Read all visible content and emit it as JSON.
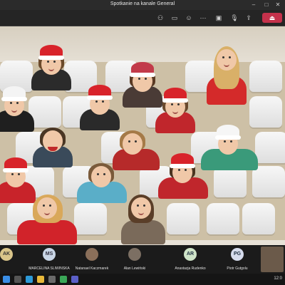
{
  "window": {
    "title": "Spotkanie na kanale General"
  },
  "toolbar": {
    "icons": [
      "participants-icon",
      "chat-icon",
      "reactions-icon",
      "more-icon",
      "camera-icon",
      "mic-icon",
      "share-icon"
    ],
    "leave_label": "⏏"
  },
  "participants": [
    {
      "initials": "AK",
      "name": "",
      "color": "#d9c58a"
    },
    {
      "initials": "MS",
      "name": "MARCELINA ŚLIWIŃSKA",
      "color": "#c9d6e6"
    },
    {
      "initials": "",
      "name": "Natanael Kaczmarek",
      "color": "#8a6f5a"
    },
    {
      "initials": "",
      "name": "Alan Lewiński",
      "color": "#7c6f63"
    },
    {
      "initials": "AR",
      "name": "Anastazja Rudenko",
      "color": "#cfe4c8"
    },
    {
      "initials": "PG",
      "name": "Piotr Gutgolu",
      "color": "#d6dced"
    }
  ],
  "taskbar": {
    "time": "12:0",
    "icons": [
      "windows-icon",
      "search-icon",
      "edge-icon",
      "folder-icon",
      "store-icon",
      "chrome-icon",
      "teams-icon"
    ]
  },
  "colors": {
    "hat": "#d8232a",
    "leave": "#c4314b",
    "seat": "#f2f2f2"
  }
}
